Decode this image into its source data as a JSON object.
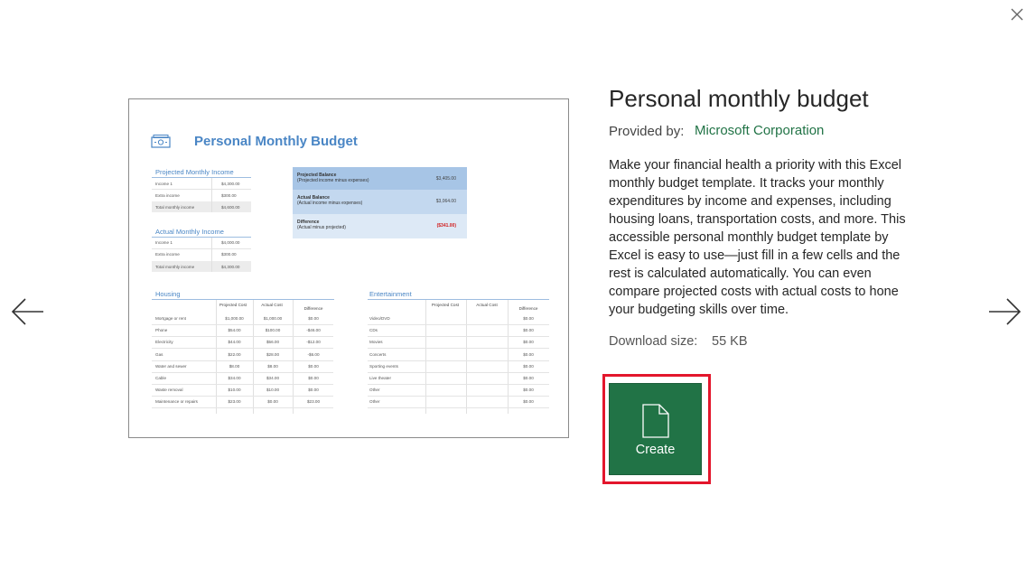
{
  "template": {
    "title": "Personal monthly budget",
    "provided_by_label": "Provided by:",
    "provider": "Microsoft Corporation",
    "description": "Make your financial health a priority with this Excel monthly budget template. It tracks your monthly expenditures by income and expenses, including housing loans, transportation costs, and more. This accessible personal monthly budget template by Excel is easy to use—just fill in a few cells and the rest is calculated automatically. You can even compare projected costs with actual costs to hone your budgeting skills over time.",
    "download_size_label": "Download size:",
    "download_size": "55 KB",
    "create_label": "Create"
  },
  "icons": {
    "close": "close-icon",
    "prev": "arrow-left-icon",
    "next": "arrow-right-icon",
    "create": "document-icon",
    "preview_logo": "money-icon"
  },
  "colors": {
    "accent": "#217346",
    "highlight": "#e3162c",
    "preview_blue": "#4a86c5"
  },
  "preview": {
    "title": "Personal Monthly Budget",
    "projected_income": {
      "heading": "Projected Monthly Income",
      "rows": [
        {
          "label": "Income 1",
          "value": "$4,300.00"
        },
        {
          "label": "Extra income",
          "value": "$300.00"
        },
        {
          "label": "Total monthly income",
          "value": "$4,600.00"
        }
      ]
    },
    "actual_income": {
      "heading": "Actual Monthly Income",
      "rows": [
        {
          "label": "Income 1",
          "value": "$4,000.00"
        },
        {
          "label": "Extra income",
          "value": "$300.00"
        },
        {
          "label": "Total monthly income",
          "value": "$4,300.00"
        }
      ]
    },
    "balances": [
      {
        "label": "Projected Balance",
        "sub": "(Projected income minus expenses)",
        "value": "$3,405.00"
      },
      {
        "label": "Actual Balance",
        "sub": "(Actual income minus expenses)",
        "value": "$3,064.00"
      },
      {
        "label": "Difference",
        "sub": "(Actual minus projected)",
        "value": "($341.00)"
      }
    ],
    "housing": {
      "heading": "Housing",
      "columns": [
        "Projected Cost",
        "Actual Cost",
        "Difference"
      ],
      "rows": [
        [
          "Mortgage or rent",
          "$1,000.00",
          "$1,000.00",
          "$0.00"
        ],
        [
          "Phone",
          "$54.00",
          "$100.00",
          "-$46.00"
        ],
        [
          "Electricity",
          "$44.00",
          "$56.00",
          "-$12.00"
        ],
        [
          "Gas",
          "$22.00",
          "$28.00",
          "-$6.00"
        ],
        [
          "Water and sewer",
          "$8.00",
          "$8.00",
          "$0.00"
        ],
        [
          "Cable",
          "$34.00",
          "$34.00",
          "$0.00"
        ],
        [
          "Waste removal",
          "$10.00",
          "$10.00",
          "$0.00"
        ],
        [
          "Maintenance or repairs",
          "$23.00",
          "$0.00",
          "$23.00"
        ]
      ]
    },
    "entertainment": {
      "heading": "Entertainment",
      "columns": [
        "Projected Cost",
        "Actual Cost",
        "Difference"
      ],
      "rows": [
        [
          "Video/DVD",
          "",
          "",
          "$0.00"
        ],
        [
          "CDs",
          "",
          "",
          "$0.00"
        ],
        [
          "Movies",
          "",
          "",
          "$0.00"
        ],
        [
          "Concerts",
          "",
          "",
          "$0.00"
        ],
        [
          "Sporting events",
          "",
          "",
          "$0.00"
        ],
        [
          "Live theater",
          "",
          "",
          "$0.00"
        ],
        [
          "Other",
          "",
          "",
          "$0.00"
        ],
        [
          "Other",
          "",
          "",
          "$0.00"
        ]
      ]
    }
  }
}
